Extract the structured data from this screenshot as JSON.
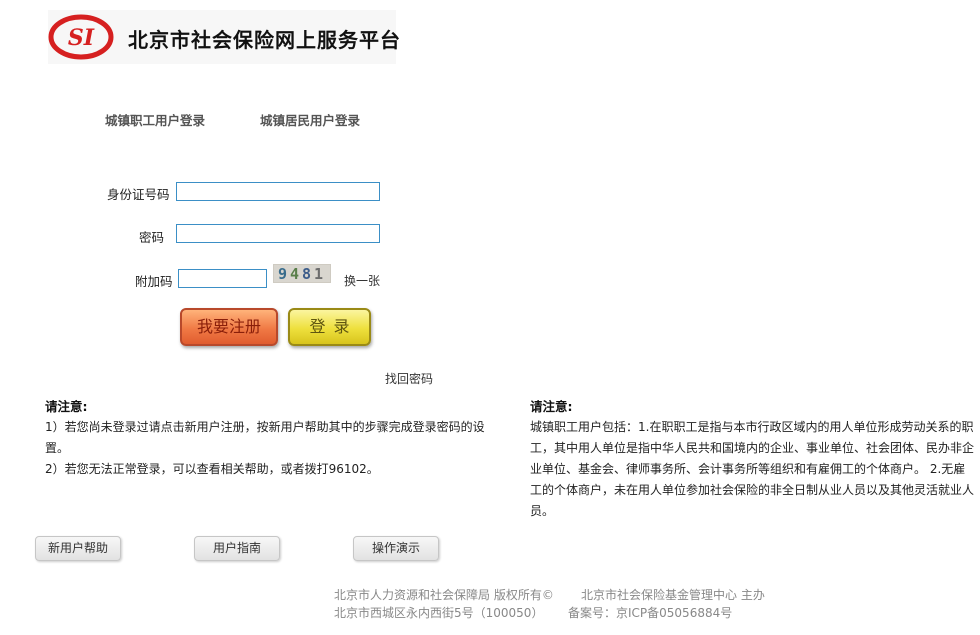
{
  "header": {
    "title": "北京市社会保险网上服务平台",
    "logo_text": "SI"
  },
  "tabs": {
    "worker_login": "城镇职工用户登录",
    "resident_login": "城镇居民用户登录"
  },
  "form": {
    "id_label": "身份证号码",
    "id_value": "",
    "password_label": "密码",
    "password_value": "",
    "captcha_label": "附加码",
    "captcha_value": "",
    "captcha_code": [
      "9",
      "4",
      "8",
      "1"
    ],
    "refresh_captcha": "换一张",
    "register_button": "我要注册",
    "login_button": "登录",
    "forgot_password": "找回密码"
  },
  "notes_left": {
    "title": "请注意:",
    "line1": "1）若您尚未登录过请点击新用户注册，按新用户帮助其中的步骤完成登录密码的设置。",
    "line2": "2）若您无法正常登录，可以查看相关帮助，或者拨打96102。"
  },
  "notes_right": {
    "title": "请注意:",
    "text": "城镇职工用户包括：1.在职职工是指与本市行政区域内的用人单位形成劳动关系的职工，其中用人单位是指中华人民共和国境内的企业、事业单位、社会团体、民办非企业单位、基金会、律师事务所、会计事务所等组织和有雇佣工的个体商户。 2.无雇工的个体商户，未在用人单位参加社会保险的非全日制从业人员以及其他灵活就业人员。"
  },
  "help_buttons": {
    "new_user_help": "新用户帮助",
    "user_guide": "用户指南",
    "demo": "操作演示"
  },
  "footer": {
    "copyright": "北京市人力资源和社会保障局 版权所有©",
    "host": "北京市社会保险基金管理中心 主办",
    "address": "北京市西城区永内西街5号（100050）",
    "icp": "备案号：京ICP备05056884号"
  },
  "colors": {
    "logo_red": "#d62020",
    "input_border": "#3b8fc6",
    "register_orange": "#f07a45",
    "login_yellow": "#eee03d"
  }
}
